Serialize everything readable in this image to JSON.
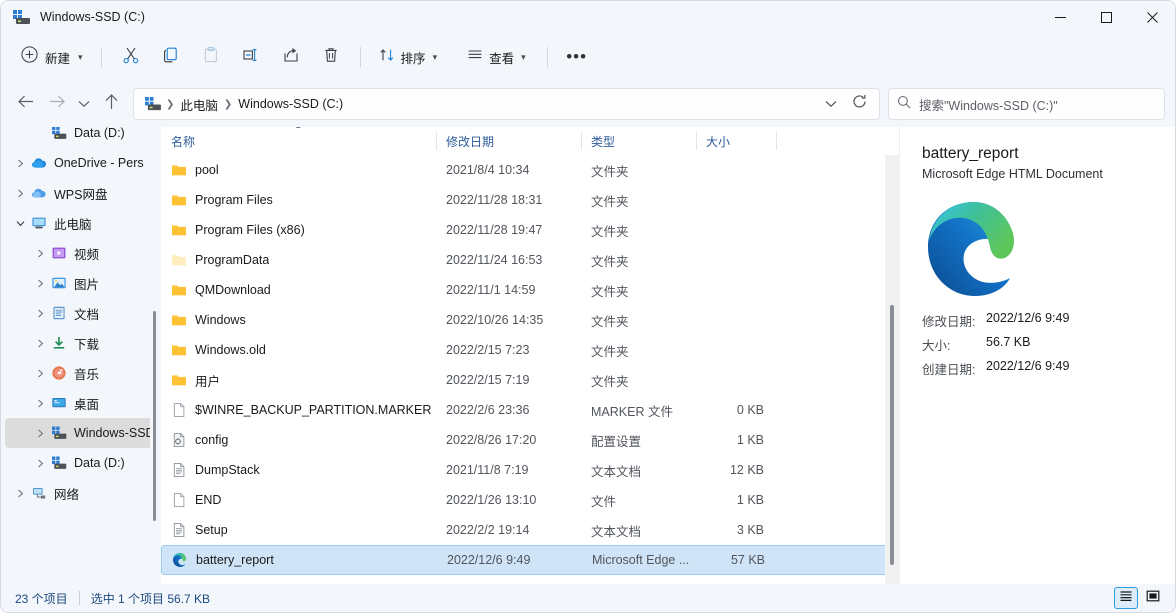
{
  "window": {
    "title": "Windows-SSD (C:)",
    "icon": "drive-icon",
    "controls": {
      "minimize": "—",
      "maximize": "□",
      "close": "✕"
    }
  },
  "toolbar": {
    "new_label": "新建",
    "new_icon": "plus-circle-icon",
    "cut_icon": "cut-icon",
    "copy_icon": "copy-icon",
    "paste_icon": "paste-icon",
    "rename_icon": "rename-icon",
    "share_icon": "share-icon",
    "delete_icon": "trash-icon",
    "sort_label": "排序",
    "sort_icon": "sort-icon",
    "view_label": "查看",
    "view_icon": "list-icon",
    "more_label": "•••"
  },
  "address": {
    "back_icon": "back-arrow-icon",
    "forward_icon": "forward-arrow-icon",
    "recent_icon": "chevron-down-icon",
    "up_icon": "up-arrow-icon",
    "path_icon": "drive-icon",
    "crumbs": [
      "此电脑",
      "Windows-SSD (C:)"
    ],
    "dropdown_icon": "chevron-down-icon",
    "refresh_icon": "refresh-icon",
    "search_icon": "search-icon",
    "search_placeholder": "搜索\"Windows-SSD (C:)\""
  },
  "sidebar": {
    "items": [
      {
        "label": "Data (D:)",
        "icon": "drive-icon",
        "indent": 1,
        "twisty": "none",
        "selected": false
      },
      {
        "label": "OneDrive - Pers",
        "icon": "onedrive-icon",
        "indent": 0,
        "twisty": "right",
        "selected": false
      },
      {
        "label": "WPS网盘",
        "icon": "wps-cloud-icon",
        "indent": 0,
        "twisty": "right",
        "selected": false
      },
      {
        "label": "此电脑",
        "icon": "this-pc-icon",
        "indent": 0,
        "twisty": "down",
        "selected": false
      },
      {
        "label": "视频",
        "icon": "videos-icon",
        "indent": 1,
        "twisty": "right",
        "selected": false
      },
      {
        "label": "图片",
        "icon": "pictures-icon",
        "indent": 1,
        "twisty": "right",
        "selected": false
      },
      {
        "label": "文档",
        "icon": "documents-icon",
        "indent": 1,
        "twisty": "right",
        "selected": false
      },
      {
        "label": "下载",
        "icon": "downloads-icon",
        "indent": 1,
        "twisty": "right",
        "selected": false
      },
      {
        "label": "音乐",
        "icon": "music-icon",
        "indent": 1,
        "twisty": "right",
        "selected": false
      },
      {
        "label": "桌面",
        "icon": "desktop-icon",
        "indent": 1,
        "twisty": "right",
        "selected": false
      },
      {
        "label": "Windows-SSD",
        "icon": "drive-icon",
        "indent": 1,
        "twisty": "right",
        "selected": true
      },
      {
        "label": "Data (D:)",
        "icon": "drive-icon",
        "indent": 1,
        "twisty": "right",
        "selected": false
      },
      {
        "label": "网络",
        "icon": "network-icon",
        "indent": 0,
        "twisty": "right",
        "selected": false
      }
    ]
  },
  "filelist": {
    "columns": [
      {
        "key": "name",
        "label": "名称",
        "sorted": "asc"
      },
      {
        "key": "date",
        "label": "修改日期",
        "sorted": ""
      },
      {
        "key": "type",
        "label": "类型",
        "sorted": ""
      },
      {
        "key": "size",
        "label": "大小",
        "sorted": ""
      }
    ],
    "rows": [
      {
        "name": "pool",
        "date": "2021/8/4 10:34",
        "type": "文件夹",
        "size": "",
        "icon": "folder-icon",
        "selected": false
      },
      {
        "name": "Program Files",
        "date": "2022/11/28 18:31",
        "type": "文件夹",
        "size": "",
        "icon": "folder-icon",
        "selected": false
      },
      {
        "name": "Program Files (x86)",
        "date": "2022/11/28 19:47",
        "type": "文件夹",
        "size": "",
        "icon": "folder-icon",
        "selected": false
      },
      {
        "name": "ProgramData",
        "date": "2022/11/24 16:53",
        "type": "文件夹",
        "size": "",
        "icon": "folder-hidden-icon",
        "selected": false
      },
      {
        "name": "QMDownload",
        "date": "2022/11/1 14:59",
        "type": "文件夹",
        "size": "",
        "icon": "folder-icon",
        "selected": false
      },
      {
        "name": "Windows",
        "date": "2022/10/26 14:35",
        "type": "文件夹",
        "size": "",
        "icon": "folder-icon",
        "selected": false
      },
      {
        "name": "Windows.old",
        "date": "2022/2/15 7:23",
        "type": "文件夹",
        "size": "",
        "icon": "folder-icon",
        "selected": false
      },
      {
        "name": "用户",
        "date": "2022/2/15 7:19",
        "type": "文件夹",
        "size": "",
        "icon": "folder-icon",
        "selected": false
      },
      {
        "name": "$WINRE_BACKUP_PARTITION.MARKER",
        "date": "2022/2/6 23:36",
        "type": "MARKER 文件",
        "size": "0 KB",
        "icon": "blank-file-icon",
        "selected": false
      },
      {
        "name": "config",
        "date": "2022/8/26 17:20",
        "type": "配置设置",
        "size": "1 KB",
        "icon": "config-file-icon",
        "selected": false
      },
      {
        "name": "DumpStack",
        "date": "2021/11/8 7:19",
        "type": "文本文档",
        "size": "12 KB",
        "icon": "text-file-icon",
        "selected": false
      },
      {
        "name": "END",
        "date": "2022/1/26 13:10",
        "type": "文件",
        "size": "1 KB",
        "icon": "blank-file-icon",
        "selected": false
      },
      {
        "name": "Setup",
        "date": "2022/2/2 19:14",
        "type": "文本文档",
        "size": "3 KB",
        "icon": "text-file-icon",
        "selected": false
      },
      {
        "name": "battery_report",
        "date": "2022/12/6 9:49",
        "type": "Microsoft Edge ...",
        "size": "57 KB",
        "icon": "edge-icon",
        "selected": true
      }
    ]
  },
  "details": {
    "title": "battery_report",
    "subtitle": "Microsoft Edge HTML Document",
    "thumb_icon": "edge-icon",
    "props": [
      {
        "key": "修改日期:",
        "value": "2022/12/6 9:49"
      },
      {
        "key": "大小:",
        "value": "56.7 KB"
      },
      {
        "key": "创建日期:",
        "value": "2022/12/6 9:49"
      }
    ]
  },
  "statusbar": {
    "item_count": "23 个项目",
    "selection": "选中 1 个项目  56.7 KB",
    "details_view_icon": "details-view-icon",
    "large_icons_view_icon": "large-icons-view-icon"
  },
  "colors": {
    "accent": "#2f9ee0",
    "selection_bg": "#cfe4f7",
    "chrome_bg": "#f3f6fb",
    "header_text": "#2e5c9a",
    "status_text": "#1d4a80"
  }
}
